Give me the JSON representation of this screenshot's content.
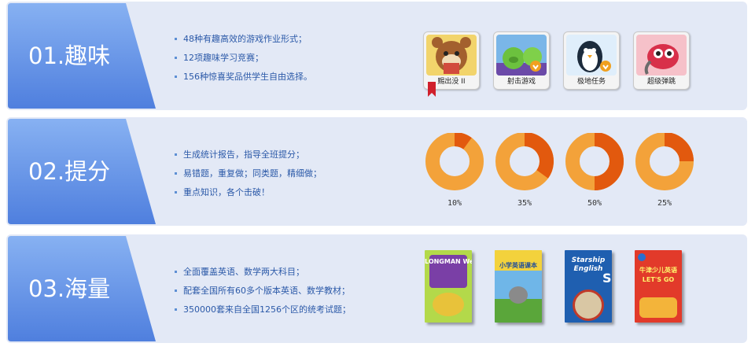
{
  "colors": {
    "panel_bg": "#e3e9f6",
    "tag_blue": "#6f9ae8",
    "bullet_text": "#2b59a8",
    "donut_light": "#f3a23a",
    "donut_dark": "#e2590e"
  },
  "sections": [
    {
      "tag": "01.趣味",
      "bullets": [
        "48种有趣高效的游戏作业形式；",
        "12项趣味学习竞赛；",
        "156种惊喜奖品供学生自由选择。"
      ],
      "apps": [
        {
          "label": "赐出没 II",
          "icon": "bear-game-icon"
        },
        {
          "label": "射击游戏",
          "icon": "pig-shooter-icon"
        },
        {
          "label": "极地任务",
          "icon": "penguin-icon"
        },
        {
          "label": "超级弹跳",
          "icon": "bird-icon"
        }
      ]
    },
    {
      "tag": "02.提分",
      "bullets": [
        "生成统计报告，指导全班提分；",
        "易错题，重复做；同类题，精细做；",
        "重点知识，各个击破！"
      ],
      "donuts": [
        {
          "label": "10%",
          "value": 10
        },
        {
          "label": "35%",
          "value": 35
        },
        {
          "label": "50%",
          "value": 50
        },
        {
          "label": "25%",
          "value": 25
        }
      ]
    },
    {
      "tag": "03.海量",
      "bullets": [
        "全面覆盖英语、数学两大科目；",
        "配套全国所有60多个版本英语、数学教材；",
        "350000套来自全国1256个区的统考试题；"
      ],
      "books": [
        {
          "title": "LONGMAN Welcome to English",
          "icon": "longman-book-cover"
        },
        {
          "title": "小学英语课本",
          "icon": "hello-english-book-cover"
        },
        {
          "title": "Starship English",
          "icon": "starship-book-cover"
        },
        {
          "title": "牛津少儿英语 LET'S GO",
          "icon": "lets-go-book-cover"
        }
      ]
    }
  ]
}
